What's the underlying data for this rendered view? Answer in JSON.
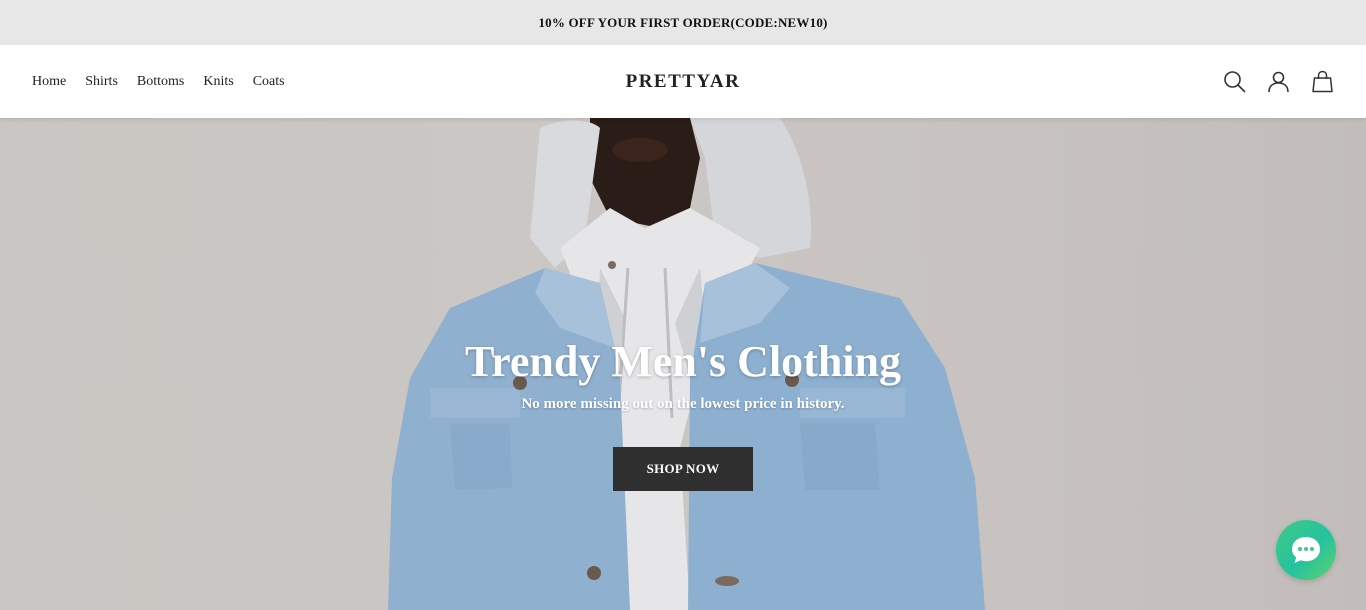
{
  "announcement": {
    "text": "10% OFF YOUR FIRST ORDER(CODE:NEW10)"
  },
  "header": {
    "nav": [
      "Home",
      "Shirts",
      "Bottoms",
      "Knits",
      "Coats"
    ],
    "logo": "PRETTYAR",
    "icons": [
      "search-icon",
      "account-icon",
      "cart-icon"
    ]
  },
  "hero": {
    "title": "Trendy Men's Clothing",
    "subtitle": "No more missing out on the lowest price in history.",
    "cta": "SHOP NOW"
  },
  "chat": {
    "icon": "chat-icon",
    "color_start": "#3ecb86",
    "color_end": "#5ad36a"
  },
  "colors": {
    "announcement_bg": "#e7e7e7",
    "button_bg": "#2f2f2f",
    "hero_bg": "#c9c5c2"
  }
}
